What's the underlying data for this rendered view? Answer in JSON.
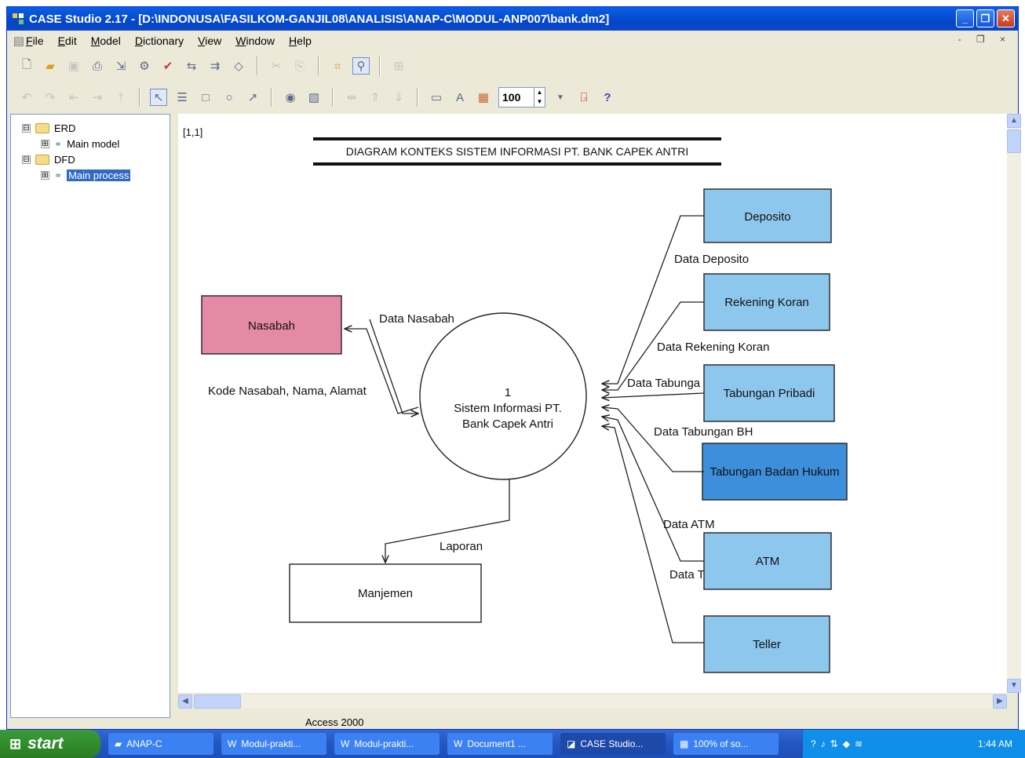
{
  "window": {
    "title": "CASE Studio 2.17 - [D:\\INDONUSA\\FASILKOM-GANJIL08\\ANALISIS\\ANAP-C\\MODUL-ANP007\\bank.dm2]",
    "minimize": "_",
    "restore": "❐",
    "close": "✕"
  },
  "menu": [
    "File",
    "Edit",
    "Model",
    "Dictionary",
    "View",
    "Window",
    "Help"
  ],
  "mdi_controls": "- ❐ ×",
  "toolbar": {
    "zoom_value": "100"
  },
  "tree": {
    "nodes": [
      {
        "label": "ERD",
        "expander": "⊟"
      },
      {
        "label": "Main model",
        "expander": "⊞"
      },
      {
        "label": "DFD",
        "expander": "⊟"
      },
      {
        "label": "Main process",
        "expander": "⊞"
      }
    ]
  },
  "diagram": {
    "page_ref": "[1,1]",
    "title": "DIAGRAM KONTEKS SISTEM INFORMASI PT. BANK CAPEK ANTRI",
    "process": {
      "number": "1",
      "line1": "Sistem Informasi  PT.",
      "line2": "Bank Capek Antri"
    },
    "entities": {
      "nasabah": "Nasabah",
      "manajemen": "Manjemen",
      "deposito": "Deposito",
      "rekening_koran": "Rekening Koran",
      "tabungan_pribadi": "Tabungan Pribadi",
      "tabungan_badan_hukum": "Tabungan Badan Hukum",
      "atm": "ATM",
      "teller": "Teller"
    },
    "flows": {
      "data_nasabah": "Data Nasabah",
      "kode_nasabah": "Kode Nasabah, Nama, Alamat",
      "laporan": "Laporan",
      "data_deposito": "Data Deposito",
      "data_rekening_koran": "Data Rekening Koran",
      "data_tabungan": "Data Tabunga",
      "data_tabungan_bh": "Data Tabungan BH",
      "data_atm": "Data ATM",
      "data_teller": "Data T"
    },
    "colors": {
      "nasabah_fill": "#e58aa6",
      "light_blue": "#8ec7ee",
      "dark_blue": "#3d8fdb"
    }
  },
  "statusbar": {
    "text": "Access 2000"
  },
  "taskbar": {
    "start": "start",
    "tasks": [
      "ANAP-C",
      "Modul-prakti...",
      "Modul-prakti...",
      "Document1 ...",
      "CASE Studio...",
      "100% of so..."
    ],
    "clock": "1:44 AM"
  }
}
